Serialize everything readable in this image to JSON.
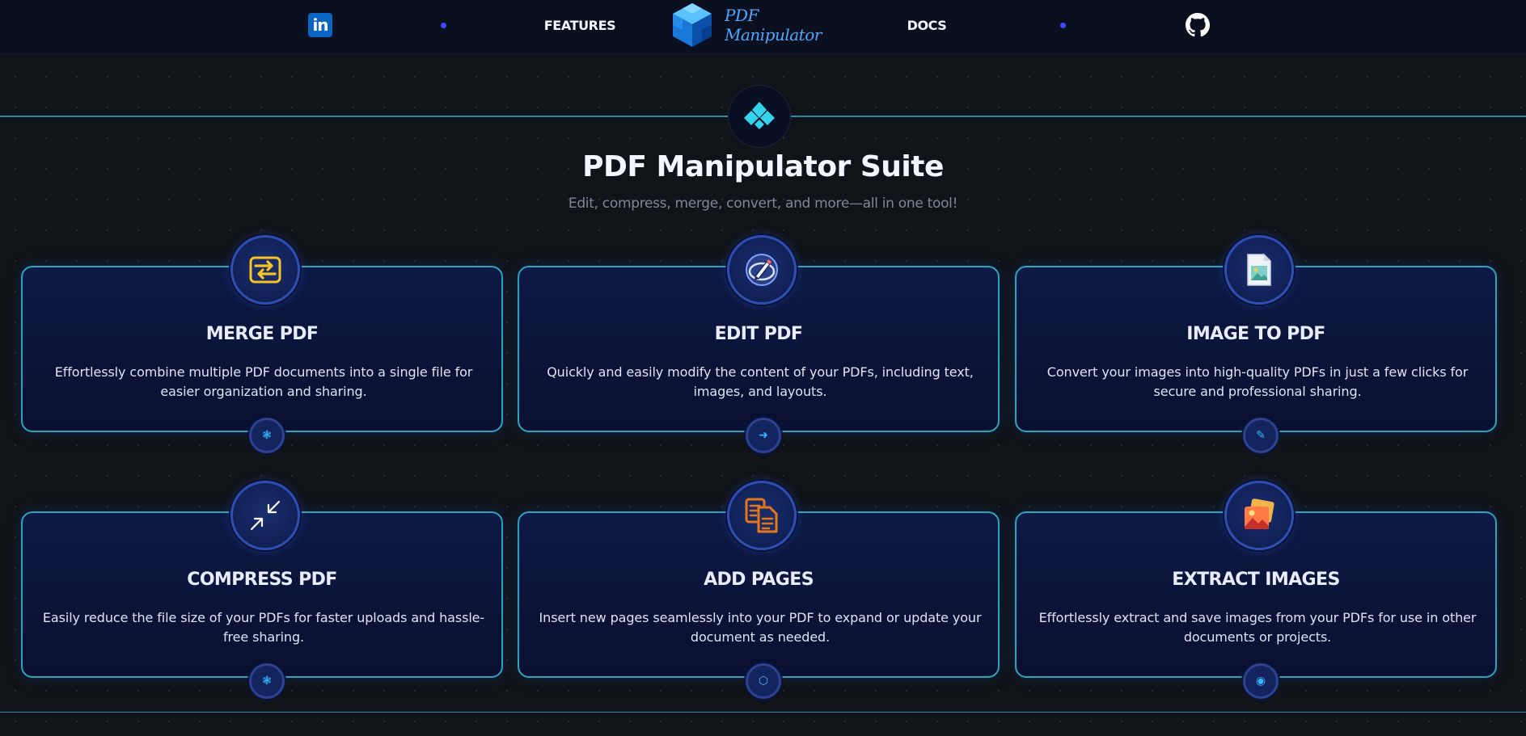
{
  "nav": {
    "linkedin_label": "in",
    "features_label": "FEATURES",
    "brand_name": "PDF Manipulator",
    "docs_label": "DOCS"
  },
  "hero": {
    "title": "PDF Manipulator Suite",
    "subtitle": "Edit, compress, merge, convert, and more—all in one tool!"
  },
  "cards": [
    {
      "title": "MERGE PDF",
      "description": "Effortlessly combine multiple PDF documents into a single file for easier organization and sharing.",
      "icon": "merge-icon",
      "knob_icon": "gear-icon"
    },
    {
      "title": "EDIT PDF",
      "description": "Quickly and easily modify the content of your PDFs, including text, images, and layouts.",
      "icon": "edit-pen-icon",
      "knob_icon": "arrow-icon"
    },
    {
      "title": "IMAGE TO PDF",
      "description": "Convert your images into high-quality PDFs in just a few clicks for secure and professional sharing.",
      "icon": "image-file-icon",
      "knob_icon": "tool-icon"
    },
    {
      "title": "COMPRESS PDF",
      "description": "Easily reduce the file size of your PDFs for faster uploads and hassle-free sharing.",
      "icon": "compress-arrows-icon",
      "knob_icon": "gear-icon"
    },
    {
      "title": "ADD PAGES",
      "description": "Insert new pages seamlessly into your PDF to expand or update your document as needed.",
      "icon": "copy-pages-icon",
      "knob_icon": "hexagon-icon"
    },
    {
      "title": "EXTRACT IMAGES",
      "description": "Effortlessly extract and save images from your PDFs for use in other documents or projects.",
      "icon": "photos-icon",
      "knob_icon": "ring-icon"
    }
  ],
  "colors": {
    "accent_line": "#1f8fa8",
    "card_border": "#2aa3c0",
    "brand_blue": "#4fa8ff",
    "linkedin_blue": "#0a66c2",
    "nav_dot": "#3b4bff"
  }
}
